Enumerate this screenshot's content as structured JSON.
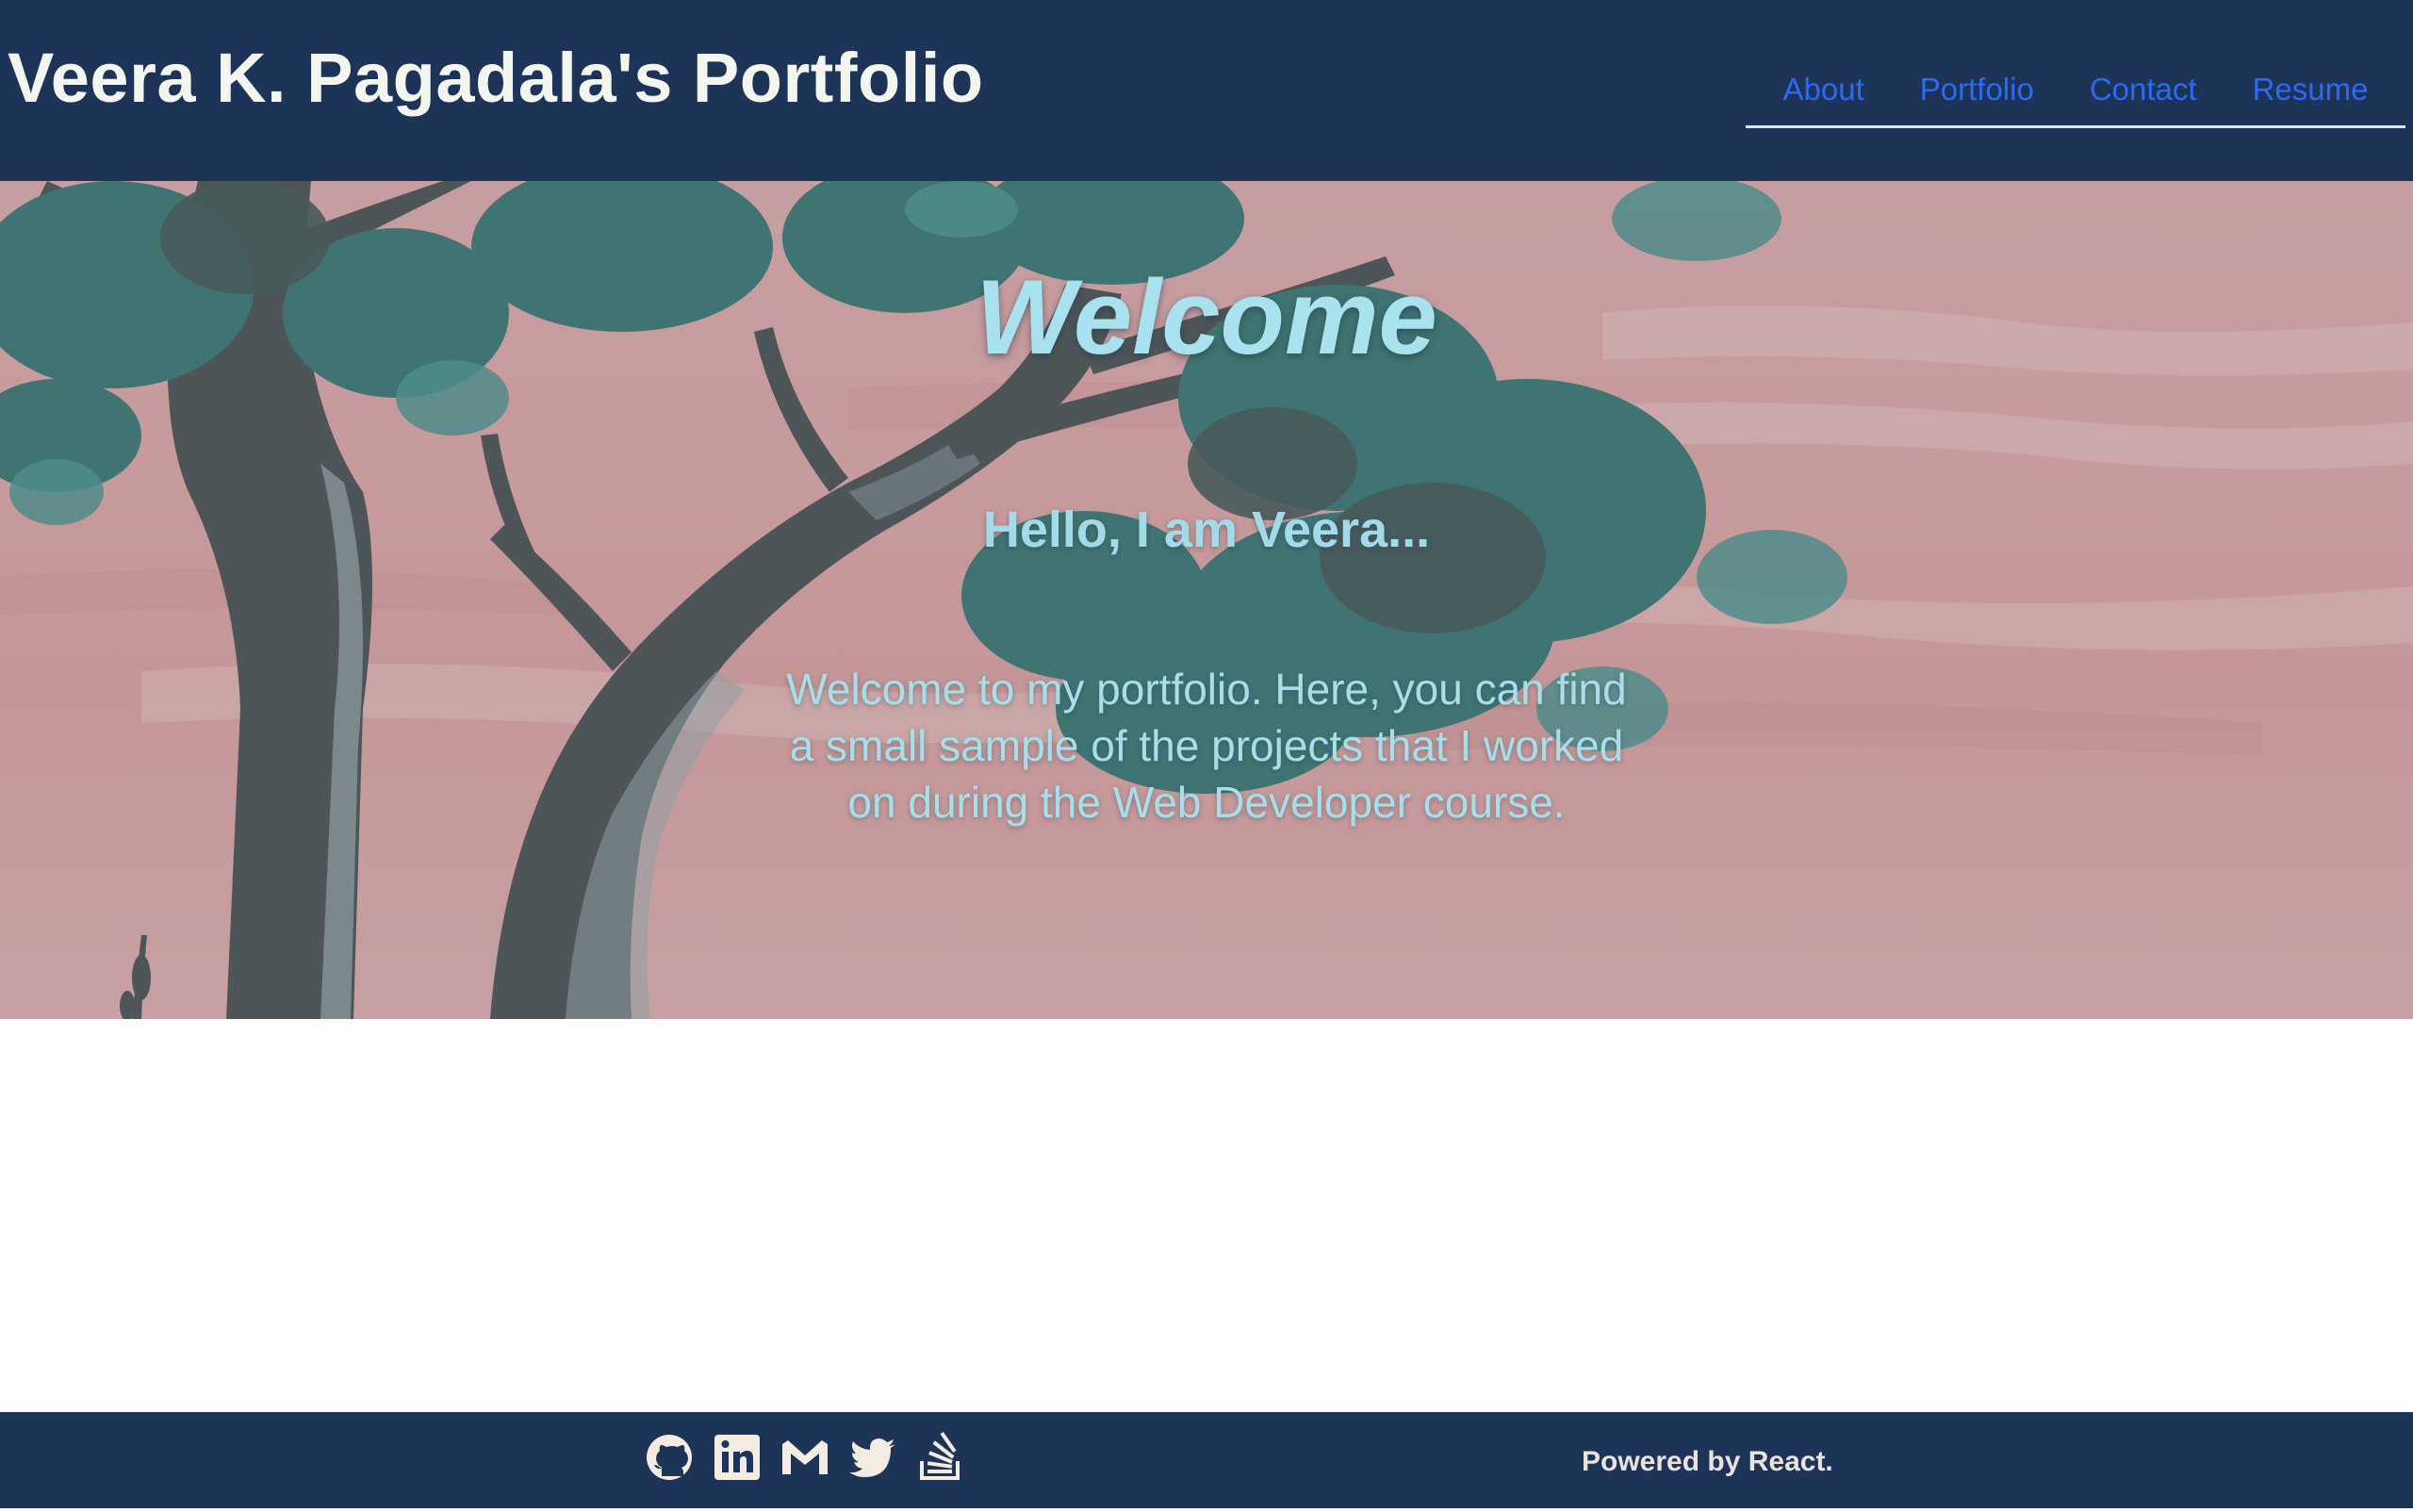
{
  "header": {
    "title": "Veera K. Pagadala's Portfolio",
    "nav": [
      "About",
      "Portfolio",
      "Contact",
      "Resume"
    ]
  },
  "hero": {
    "heading": "Welcome",
    "greeting": "Hello, I am Veera...",
    "intro": "Welcome to my portfolio. Here, you can find a small sample of the projects that I worked on during the Web Developer course."
  },
  "footer": {
    "social_icons": [
      "github-icon",
      "linkedin-icon",
      "gmail-icon",
      "twitter-icon",
      "stackoverflow-icon"
    ],
    "powered_by": "Powered by React."
  },
  "colors": {
    "header_bg": "#1e3358",
    "nav_link": "#2a6bf2",
    "title": "#f2f6ee",
    "hero_text": "#a9e2ef"
  }
}
